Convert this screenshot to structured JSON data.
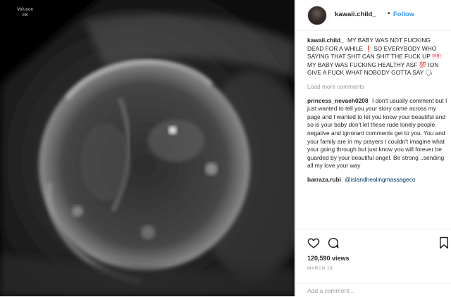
{
  "media": {
    "overlay_line1": "Voluson",
    "overlay_line2": "E8"
  },
  "header": {
    "username": "kawaii.child_",
    "separator": "•",
    "follow_label": "Follow"
  },
  "caption": {
    "username": "kawaii.child_",
    "text_1": "MY BABY WAS NOT FUCKING DEAD FOR A WHILE",
    "emoji_1": "❗",
    "text_2": "SO EVERYBODY WHO SAYING THAT SHIT CAN SHIT THE FUCK UP",
    "emoji_2": "‼‼‼",
    "text_3": "MY BABY WAS FUCKING HEALTHY ASF",
    "emoji_3": "💯",
    "text_4": "ION GIVE A FUCK WHAT NOBODY GOTTA SAY",
    "emoji_4": "🗣"
  },
  "load_more_label": "Load more comments",
  "comments": [
    {
      "username": "princess_nevaeh0208",
      "text": "I don't usually comment but I just wanted to tell you your story came across my page and I wanted to let you know your beautiful and so is your baby don't let these rude lonely people negative and ignorant comments get to you. You and your family are in my prayers I couldn't imagine what your going through but just know you will forever be guarded by your beautiful angel. Be strong ..sending all my love your way"
    },
    {
      "username": "barraza.rubi",
      "mention": "@islandhealingmassageco"
    }
  ],
  "stats": {
    "views": "120,590 views",
    "date": "MARCH 19"
  },
  "add_comment": {
    "placeholder": "Add a comment..."
  },
  "icons": {
    "like": "heart-icon",
    "comment": "comment-icon",
    "save": "bookmark-icon"
  },
  "colors": {
    "link_blue": "#3897f0",
    "emoji_red": "#e0142f",
    "muted": "#999999"
  }
}
